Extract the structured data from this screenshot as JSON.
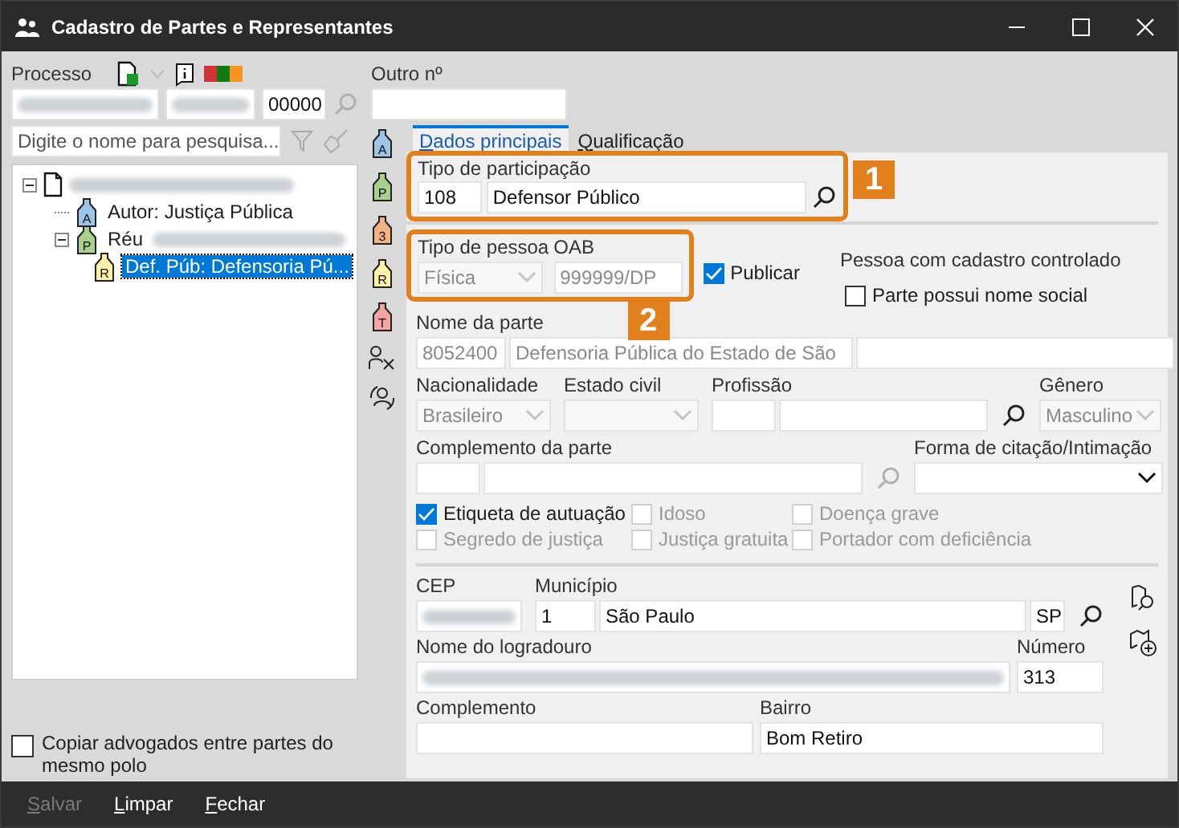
{
  "window": {
    "title": "Cadastro de Partes e Representantes"
  },
  "process": {
    "label": "Processo",
    "status_colors": [
      {
        "color": "#d13438"
      },
      {
        "color": "#107c10"
      },
      {
        "color": "#f7931e"
      }
    ],
    "fields": [
      {
        "redacted": true
      },
      {
        "redacted": true
      },
      {
        "value": "00000"
      }
    ]
  },
  "other_number": {
    "label": "Outro nº"
  },
  "search": {
    "placeholder": "Digite o nome para pesquisa..."
  },
  "tree": [
    {
      "kind": "process",
      "redacted": true,
      "expanded": true,
      "selected": false,
      "children": [
        {
          "kind": "party",
          "letter": "A",
          "color": "#9dc3e6",
          "label": "Autor: Justiça Pública",
          "selected": false
        },
        {
          "kind": "party",
          "letter": "P",
          "color": "#a9d18e",
          "label": "Réu",
          "redacted": true,
          "expanded": true,
          "selected": false,
          "children": [
            {
              "kind": "party",
              "letter": "R",
              "color": "#fff2a8",
              "label": "Def. Púb: Defensoria Pú...",
              "selected": true
            }
          ]
        }
      ]
    }
  ],
  "copy_lawyers": {
    "label": "Copiar advogados entre partes do mesmo polo",
    "checked": false
  },
  "role_buttons": [
    {
      "letter": "A",
      "color": "#9dc3e6"
    },
    {
      "letter": "P",
      "color": "#a9d18e"
    },
    {
      "letter": "3",
      "color": "#f4b183"
    },
    {
      "letter": "R",
      "color": "#fff2a8"
    },
    {
      "letter": "T",
      "color": "#f4a3a3"
    }
  ],
  "tabs": [
    {
      "label": "Dados principais",
      "selected": true
    },
    {
      "label": "Qualificação",
      "selected": false
    }
  ],
  "participation": {
    "label": "Tipo de participação",
    "code": "108",
    "value": "Defensor Público"
  },
  "person_type": {
    "label": "Tipo de pessoa",
    "value": "Física",
    "disabled": true
  },
  "oab": {
    "label": "OAB",
    "value": "999999/DP",
    "disabled": true
  },
  "publish": {
    "label": "Publicar",
    "checked": true,
    "disabled": false
  },
  "controlled": {
    "label": "Pessoa com cadastro controlado"
  },
  "social_name": {
    "label": "Parte possui nome social",
    "checked": false,
    "disabled": false
  },
  "party_name": {
    "label": "Nome da parte",
    "code": "8052400",
    "value": "Defensoria Pública do Estado de São",
    "disabled": true
  },
  "nationality": {
    "label": "Nacionalidade",
    "value": "Brasileiro",
    "disabled": true
  },
  "civil_status": {
    "label": "Estado civil",
    "disabled": true
  },
  "profession": {
    "label": "Profissão"
  },
  "gender": {
    "label": "Gênero",
    "value": "Masculino",
    "disabled": true
  },
  "party_complement": {
    "label": "Complemento da parte"
  },
  "citation_form": {
    "label": "Forma de citação/Intimação",
    "disabled": false
  },
  "flags": [
    {
      "label": "Etiqueta de autuação",
      "checked": true,
      "disabled": false
    },
    {
      "label": "Idoso",
      "checked": false,
      "disabled": true
    },
    {
      "label": "Doença grave",
      "checked": false,
      "disabled": true
    },
    {
      "label": "Segredo de justiça",
      "checked": false,
      "disabled": true
    },
    {
      "label": "Justiça gratuita",
      "checked": false,
      "disabled": true
    },
    {
      "label": "Portador com deficiência",
      "checked": false,
      "disabled": true
    }
  ],
  "cep": {
    "label": "CEP",
    "redacted": true
  },
  "city": {
    "label": "Município",
    "code": "1",
    "value": "São Paulo",
    "state": "SP"
  },
  "street": {
    "label": "Nome do logradouro",
    "redacted": true
  },
  "number": {
    "label": "Número",
    "value": "313"
  },
  "complement": {
    "label": "Complemento"
  },
  "district": {
    "label": "Bairro",
    "value": "Bom Retiro"
  },
  "callouts": [
    {
      "label": "1"
    },
    {
      "label": "2"
    }
  ],
  "actions": [
    {
      "label": "Salvar",
      "disabled": true
    },
    {
      "label": "Limpar",
      "disabled": false
    },
    {
      "label": "Fechar",
      "disabled": false
    }
  ]
}
